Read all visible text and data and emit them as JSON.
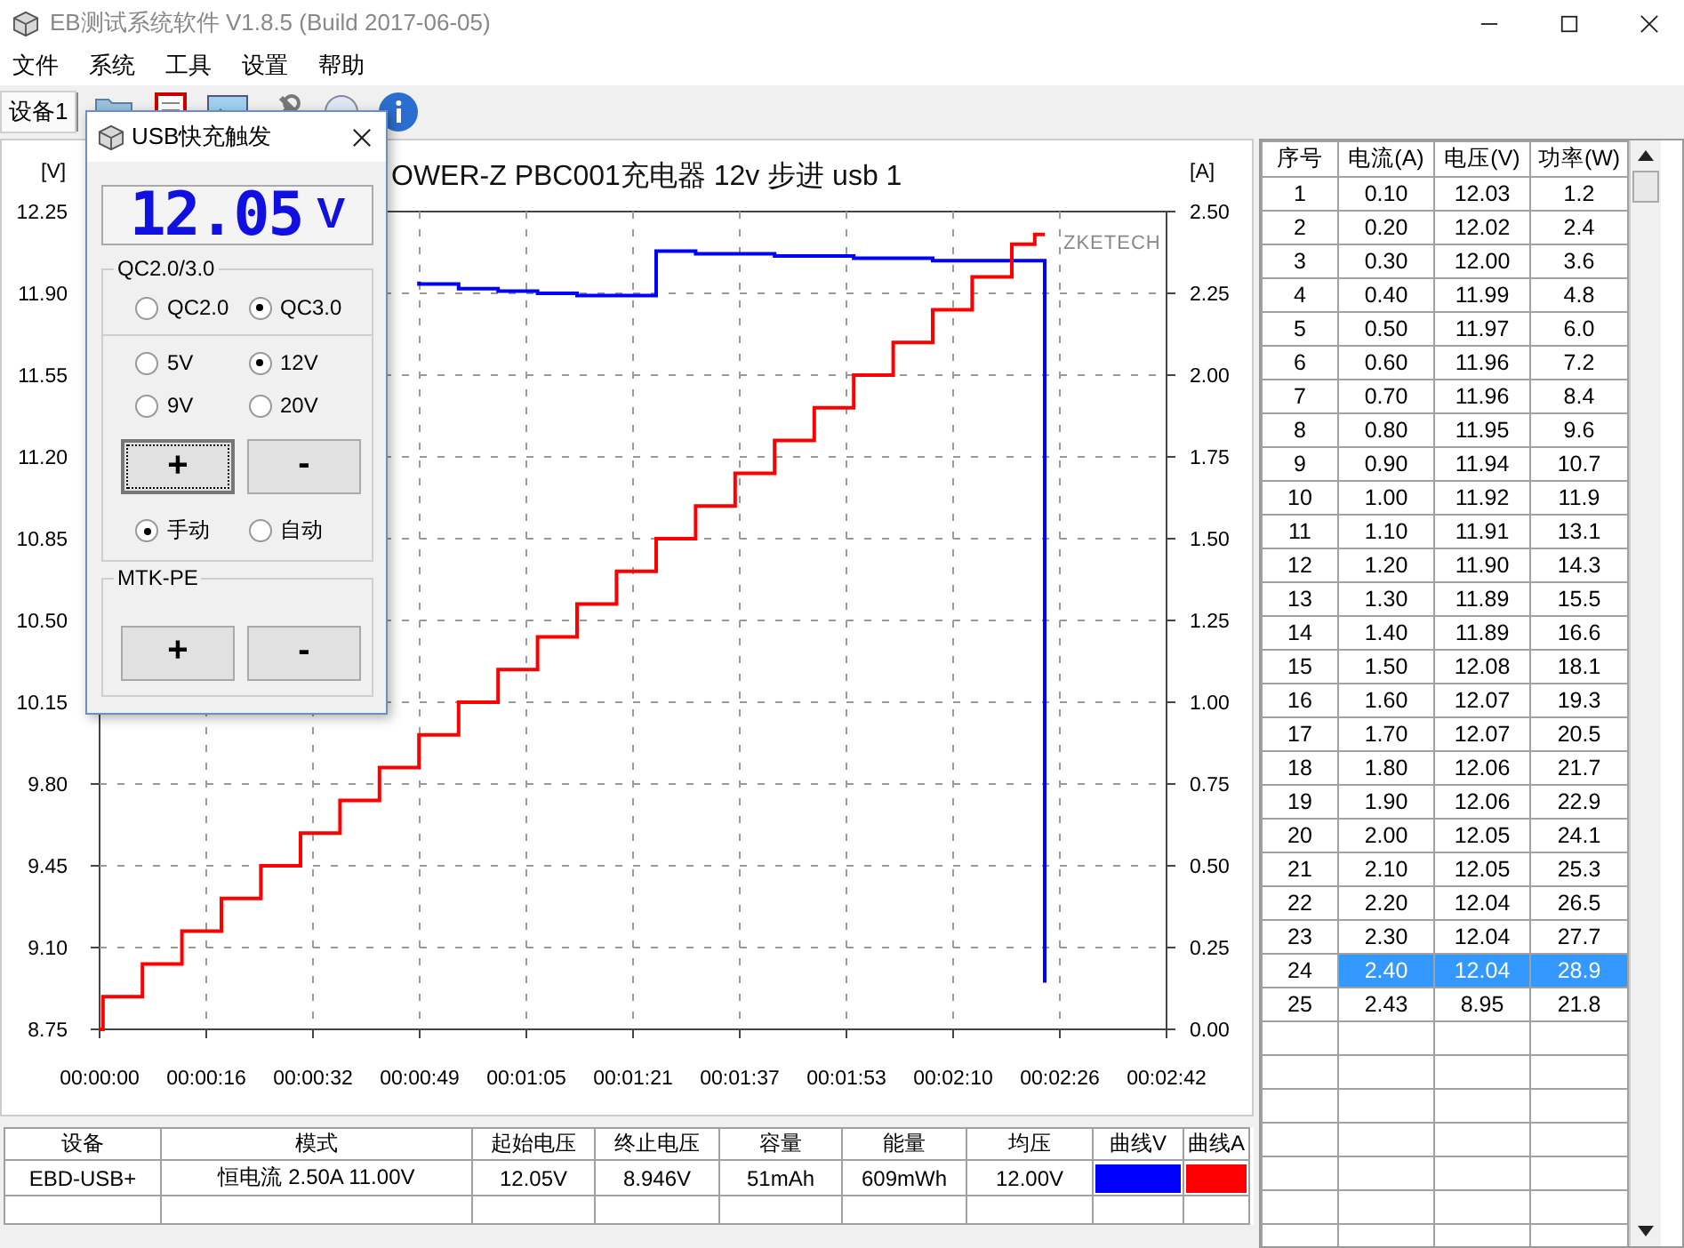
{
  "window": {
    "title": "EB测试系统软件 V1.8.5 (Build 2017-06-05)"
  },
  "menu": [
    "文件",
    "系统",
    "工具",
    "设置",
    "帮助"
  ],
  "tabs": [
    {
      "label": "设备1",
      "selected": true
    }
  ],
  "chart": {
    "chart_data": {
      "type": "line",
      "title": "OWER-Z PBC001充电器  12v 步进  usb 1",
      "ylabel": "[V]",
      "y2label": "[A]",
      "x": [
        0,
        0.5,
        0.5,
        6.5,
        6.5,
        12.5,
        12.5,
        18.5,
        18.5,
        24.5,
        24.5,
        30.5,
        30.5,
        36.5,
        36.5,
        42.5,
        42.5,
        48.5,
        48.5,
        54.5,
        54.5,
        60.5,
        60.5,
        66.5,
        66.5,
        72.5,
        72.5,
        78.5,
        78.5,
        84.5,
        84.5,
        90.5,
        90.5,
        96.5,
        96.5,
        102.5,
        102.5,
        108.5,
        108.5,
        114.5,
        114.5,
        120.5,
        120.5,
        126.5,
        126.5,
        132.5,
        132.5,
        138.5,
        138.5,
        142,
        142,
        143.5,
        143.5
      ],
      "series": [
        {
          "color": "#0000ff",
          "values": [
            null,
            null,
            null,
            null,
            null,
            null,
            null,
            null,
            null,
            null,
            null,
            null,
            null,
            null,
            null,
            null,
            null,
            11.95,
            11.94,
            11.94,
            11.92,
            11.92,
            11.91,
            11.91,
            11.9,
            11.9,
            11.89,
            11.89,
            11.89,
            11.89,
            12.08,
            12.08,
            12.07,
            12.07,
            12.07,
            12.07,
            12.06,
            12.06,
            12.06,
            12.06,
            12.05,
            12.05,
            12.05,
            12.05,
            12.04,
            12.04,
            12.04,
            12.04,
            12.04,
            12.04,
            12.04,
            12.04,
            8.95
          ]
        },
        {
          "color": "#ff0000",
          "axis": "y2",
          "values": [
            0,
            0,
            0.1,
            0.1,
            0.2,
            0.2,
            0.3,
            0.3,
            0.4,
            0.4,
            0.5,
            0.5,
            0.6,
            0.6,
            0.7,
            0.7,
            0.8,
            0.8,
            0.9,
            0.9,
            1.0,
            1.0,
            1.1,
            1.1,
            1.2,
            1.2,
            1.3,
            1.3,
            1.4,
            1.4,
            1.5,
            1.5,
            1.6,
            1.6,
            1.7,
            1.7,
            1.8,
            1.8,
            1.9,
            1.9,
            2.0,
            2.0,
            2.1,
            2.1,
            2.2,
            2.2,
            2.3,
            2.3,
            2.4,
            2.4,
            2.43,
            2.43,
            2.43
          ]
        }
      ],
      "grid": true,
      "xlim": [
        0,
        162
      ],
      "ylim": [
        8.75,
        12.25
      ],
      "y2lim": [
        0,
        2.5
      ],
      "xticks": [
        {
          "value": 0,
          "label": "00:00:00"
        },
        {
          "value": 16.2,
          "label": "00:00:16"
        },
        {
          "value": 32.4,
          "label": "00:00:32"
        },
        {
          "value": 48.6,
          "label": "00:00:49"
        },
        {
          "value": 64.8,
          "label": "00:01:05"
        },
        {
          "value": 81,
          "label": "00:01:21"
        },
        {
          "value": 97.2,
          "label": "00:01:37"
        },
        {
          "value": 113.4,
          "label": "00:01:53"
        },
        {
          "value": 129.6,
          "label": "00:02:10"
        },
        {
          "value": 145.8,
          "label": "00:02:26"
        },
        {
          "value": 162,
          "label": "00:02:42"
        }
      ],
      "yticks": [
        {
          "value": 8.75,
          "label": "8.75"
        },
        {
          "value": 9.1,
          "label": "9.10"
        },
        {
          "value": 9.45,
          "label": "9.45"
        },
        {
          "value": 9.8,
          "label": "9.80"
        },
        {
          "value": 10.15,
          "label": "10.15"
        },
        {
          "value": 10.5,
          "label": "10.50"
        },
        {
          "value": 10.85,
          "label": "10.85"
        },
        {
          "value": 11.2,
          "label": "11.20"
        },
        {
          "value": 11.55,
          "label": "11.55"
        },
        {
          "value": 11.9,
          "label": "11.90"
        },
        {
          "value": 12.25,
          "label": "12.25"
        }
      ],
      "y2ticks": [
        {
          "value": 0,
          "label": "0.00"
        },
        {
          "value": 0.25,
          "label": "0.25"
        },
        {
          "value": 0.5,
          "label": "0.50"
        },
        {
          "value": 0.75,
          "label": "0.75"
        },
        {
          "value": 1,
          "label": "1.00"
        },
        {
          "value": 1.25,
          "label": "1.25"
        },
        {
          "value": 1.5,
          "label": "1.50"
        },
        {
          "value": 1.75,
          "label": "1.75"
        },
        {
          "value": 2,
          "label": "2.00"
        },
        {
          "value": 2.25,
          "label": "2.25"
        },
        {
          "value": 2.5,
          "label": "2.50"
        }
      ],
      "annotations": [
        {
          "text": "ZKETECH"
        }
      ]
    }
  },
  "readings": {
    "columns": [
      "序号",
      "电流(A)",
      "电压(V)",
      "功率(W)"
    ],
    "rows": [
      {
        "cells": [
          "1",
          "0.10",
          "12.03",
          "1.2"
        ],
        "selected": false
      },
      {
        "cells": [
          "2",
          "0.20",
          "12.02",
          "2.4"
        ],
        "selected": false
      },
      {
        "cells": [
          "3",
          "0.30",
          "12.00",
          "3.6"
        ],
        "selected": false
      },
      {
        "cells": [
          "4",
          "0.40",
          "11.99",
          "4.8"
        ],
        "selected": false
      },
      {
        "cells": [
          "5",
          "0.50",
          "11.97",
          "6.0"
        ],
        "selected": false
      },
      {
        "cells": [
          "6",
          "0.60",
          "11.96",
          "7.2"
        ],
        "selected": false
      },
      {
        "cells": [
          "7",
          "0.70",
          "11.96",
          "8.4"
        ],
        "selected": false
      },
      {
        "cells": [
          "8",
          "0.80",
          "11.95",
          "9.6"
        ],
        "selected": false
      },
      {
        "cells": [
          "9",
          "0.90",
          "11.94",
          "10.7"
        ],
        "selected": false
      },
      {
        "cells": [
          "10",
          "1.00",
          "11.92",
          "11.9"
        ],
        "selected": false
      },
      {
        "cells": [
          "11",
          "1.10",
          "11.91",
          "13.1"
        ],
        "selected": false
      },
      {
        "cells": [
          "12",
          "1.20",
          "11.90",
          "14.3"
        ],
        "selected": false
      },
      {
        "cells": [
          "13",
          "1.30",
          "11.89",
          "15.5"
        ],
        "selected": false
      },
      {
        "cells": [
          "14",
          "1.40",
          "11.89",
          "16.6"
        ],
        "selected": false
      },
      {
        "cells": [
          "15",
          "1.50",
          "12.08",
          "18.1"
        ],
        "selected": false
      },
      {
        "cells": [
          "16",
          "1.60",
          "12.07",
          "19.3"
        ],
        "selected": false
      },
      {
        "cells": [
          "17",
          "1.70",
          "12.07",
          "20.5"
        ],
        "selected": false
      },
      {
        "cells": [
          "18",
          "1.80",
          "12.06",
          "21.7"
        ],
        "selected": false
      },
      {
        "cells": [
          "19",
          "1.90",
          "12.06",
          "22.9"
        ],
        "selected": false
      },
      {
        "cells": [
          "20",
          "2.00",
          "12.05",
          "24.1"
        ],
        "selected": false
      },
      {
        "cells": [
          "21",
          "2.10",
          "12.05",
          "25.3"
        ],
        "selected": false
      },
      {
        "cells": [
          "22",
          "2.20",
          "12.04",
          "26.5"
        ],
        "selected": false
      },
      {
        "cells": [
          "23",
          "2.30",
          "12.04",
          "27.7"
        ],
        "selected": false
      },
      {
        "cells": [
          "24",
          "2.40",
          "12.04",
          "28.9"
        ],
        "selected": true
      },
      {
        "cells": [
          "25",
          "2.43",
          "8.95",
          "21.8"
        ],
        "selected": false
      }
    ]
  },
  "summary": {
    "columns": [
      "设备",
      "模式",
      "起始电压",
      "终止电压",
      "容量",
      "能量",
      "均压",
      "曲线V",
      "曲线A"
    ],
    "rows": [
      {
        "cells": [
          "EBD-USB+",
          "恒电流  2.50A  11.00V",
          "12.05V",
          "8.946V",
          "51mAh",
          "609mWh",
          "12.00V"
        ],
        "curves": [
          {
            "color": "#0000ff"
          },
          {
            "color": "#ff0000"
          }
        ]
      }
    ]
  },
  "dialog": {
    "title": "USB快充触发",
    "display": {
      "value": "12.05",
      "unit": "V"
    },
    "groups": [
      {
        "kind": "radios",
        "legend": "QC2.0/3.0",
        "options": [
          {
            "label": "QC2.0",
            "selected": false
          },
          {
            "label": "QC3.0",
            "selected": true
          }
        ]
      },
      {
        "kind": "voltage",
        "options": [
          {
            "label": "5V",
            "selected": false
          },
          {
            "label": "12V",
            "selected": true
          },
          {
            "label": "9V",
            "selected": false
          },
          {
            "label": "20V",
            "selected": false
          }
        ],
        "buttons": [
          {
            "label": "+",
            "focused": true
          },
          {
            "label": "-",
            "focused": false
          }
        ],
        "modes": [
          {
            "label": "手动",
            "selected": true
          },
          {
            "label": "自动",
            "selected": false
          }
        ]
      },
      {
        "kind": "buttons",
        "legend": "MTK-PE",
        "buttons": [
          {
            "label": "+",
            "focused": false
          },
          {
            "label": "-",
            "focused": false
          }
        ]
      }
    ]
  }
}
